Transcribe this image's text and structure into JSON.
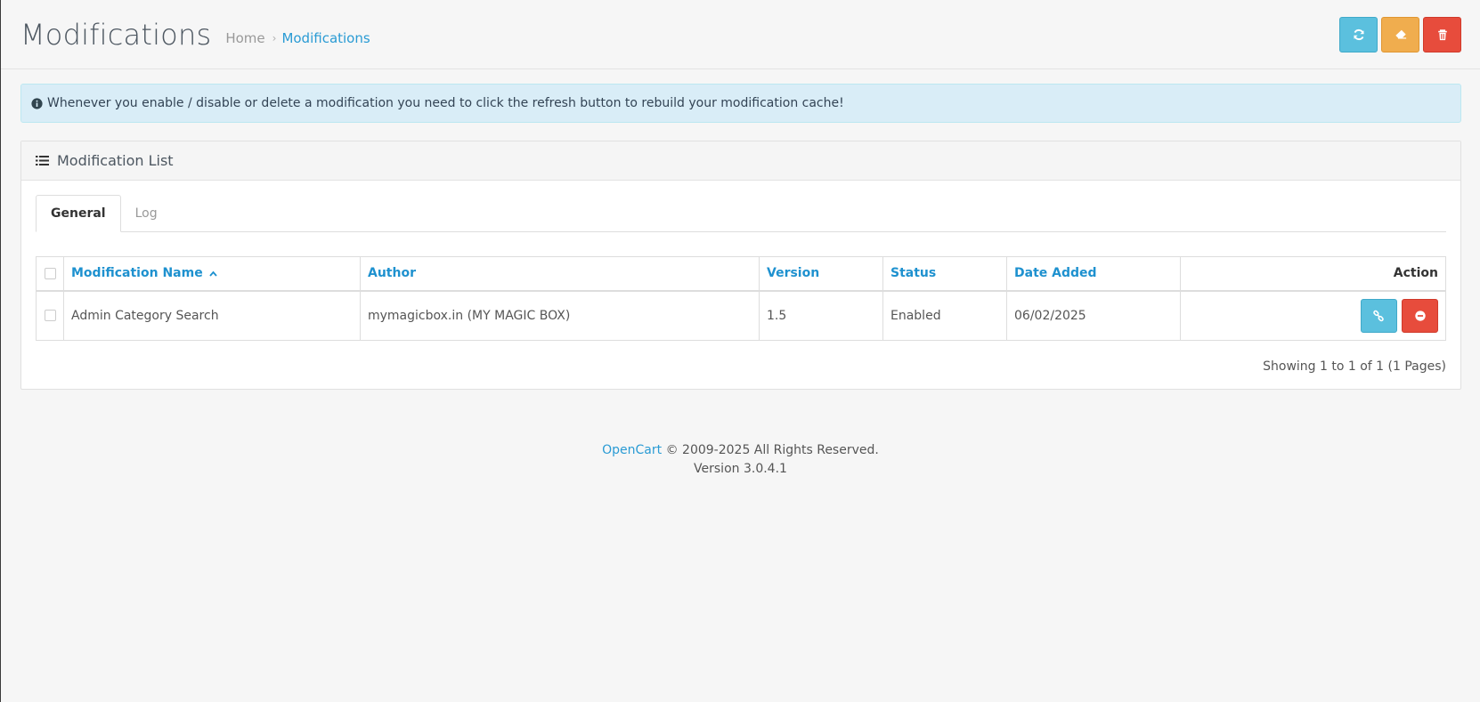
{
  "header": {
    "title": "Modifications",
    "breadcrumb": [
      {
        "label": "Home"
      },
      {
        "label": "Modifications"
      }
    ],
    "breadcrumb_sep": "›",
    "colors": {
      "info": "#5bc0de",
      "warning": "#f0ad4e",
      "danger": "#e74c3c",
      "link": "#2a9bd4"
    },
    "actions": [
      {
        "icon": "refresh-icon"
      },
      {
        "icon": "eraser-icon"
      },
      {
        "icon": "trash-icon"
      }
    ]
  },
  "alert": {
    "icon": "info-circle-icon",
    "text": "Whenever you enable / disable or delete a modification you need to click the refresh button to rebuild your modification cache!"
  },
  "panel": {
    "icon": "list-icon",
    "title": "Modification List",
    "tabs": [
      {
        "label": "General",
        "active": true
      },
      {
        "label": "Log",
        "active": false
      }
    ],
    "table": {
      "columns": {
        "name": "Modification Name",
        "author": "Author",
        "version": "Version",
        "status": "Status",
        "date_added": "Date Added",
        "action": "Action"
      },
      "sort_icon": "caret-up-icon",
      "rows": [
        {
          "name": "Admin Category Search",
          "author": "mymagicbox.in (MY MAGIC BOX)",
          "version": "1.5",
          "status": "Enabled",
          "date_added": "06/02/2025",
          "actions": [
            {
              "icon": "link-icon"
            },
            {
              "icon": "minus-circle-icon"
            }
          ]
        }
      ]
    },
    "pagination_text": "Showing 1 to 1 of 1 (1 Pages)"
  },
  "footer": {
    "brand": "OpenCart",
    "copyright": "© 2009-2025 All Rights Reserved.",
    "version": "Version 3.0.4.1"
  }
}
